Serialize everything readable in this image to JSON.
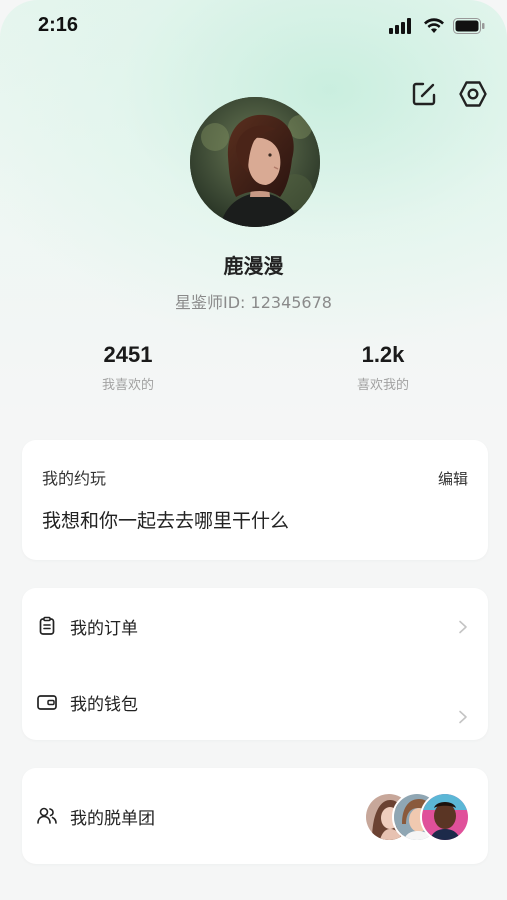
{
  "status_bar": {
    "time": "2:16"
  },
  "profile": {
    "name": "鹿漫漫",
    "id_text": "星鉴师ID: 12345678"
  },
  "stats": [
    {
      "value": "2451",
      "label": "我喜欢的"
    },
    {
      "value": "1.2k",
      "label": "喜欢我的"
    }
  ],
  "date_card": {
    "title": "我的约玩",
    "edit_label": "编辑",
    "content": "我想和你一起去去哪里干什么"
  },
  "menu": {
    "orders_label": "我的订单",
    "wallet_label": "我的钱包"
  },
  "group": {
    "label": "我的脱单团"
  },
  "colors": {
    "background": "#f5f6f6",
    "accent_gradient": "#d9f2e6",
    "card": "#ffffff"
  },
  "icons": {
    "edit": "edit-square-icon",
    "settings": "hexagon-gear-icon",
    "orders": "clipboard-icon",
    "wallet": "wallet-icon",
    "group": "users-icon",
    "chevron": "chevron-right-icon"
  }
}
